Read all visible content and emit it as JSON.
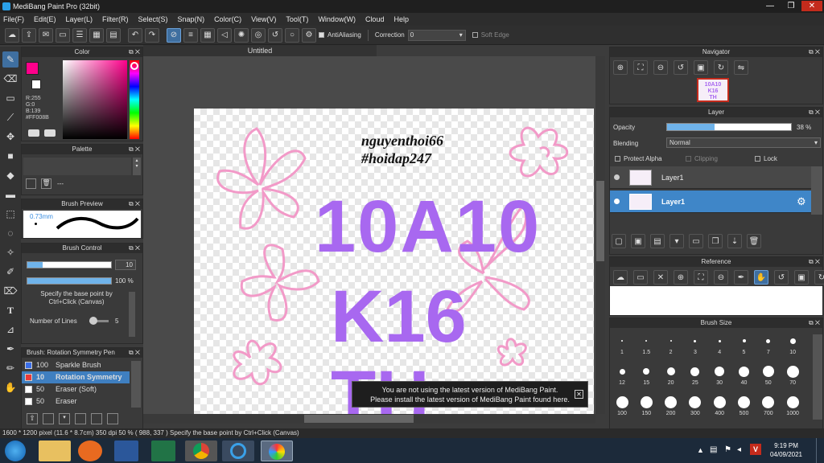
{
  "window": {
    "title": "MediBang Paint Pro (32bit)",
    "minimize": "—",
    "restore": "❐",
    "close": "✕"
  },
  "menu": [
    "File(F)",
    "Edit(E)",
    "Layer(L)",
    "Filter(R)",
    "Select(S)",
    "Snap(N)",
    "Color(C)",
    "View(V)",
    "Tool(T)",
    "Window(W)",
    "Cloud",
    "Help"
  ],
  "toolbar": {
    "antialiasing_label": "AntiAliasing",
    "correction_label": "Correction",
    "correction_value": "0",
    "soft_edge_label": "Soft Edge"
  },
  "color_panel": {
    "title": "Color",
    "r": "R:255",
    "g": "G:0",
    "b": "B:139",
    "hex": "#FF008B",
    "accent": "#ff008b"
  },
  "palette_panel": {
    "title": "Palette",
    "dash": "---"
  },
  "brush_preview": {
    "title": "Brush Preview",
    "size": "0.73mm"
  },
  "brush_control": {
    "title": "Brush Control",
    "size_value": "10",
    "opacity_value": "100 %",
    "hint": "Specify the base point by Ctrl+Click (Canvas)",
    "lines_label": "Number of Lines",
    "lines_value": "5"
  },
  "brush_list": {
    "title": "Brush: Rotation Symmetry Pen",
    "items": [
      {
        "size": "100",
        "name": "Sparkle Brush",
        "color": "#3a6ee8"
      },
      {
        "size": "10",
        "name": "Rotation Symmetry",
        "color": "#e83a3a"
      },
      {
        "size": "50",
        "name": "Eraser (Soft)",
        "color": "#ffffff"
      },
      {
        "size": "50",
        "name": "Eraser",
        "color": "#ffffff"
      }
    ]
  },
  "canvas": {
    "tab_title": "Untitled",
    "text_line1": "nguyenthoi66",
    "text_line2": "#hoidap247",
    "big_line1": "10A10",
    "big_line2": "K16",
    "big_line3": "TH",
    "notice_line1": "You are not using the latest version of MediBang Paint.",
    "notice_line2": "Please install the latest version of MediBang Paint found here."
  },
  "navigator": {
    "title": "Navigator"
  },
  "layer_panel": {
    "title": "Layer",
    "opacity_label": "Opacity",
    "opacity_value": "38 %",
    "opacity_fraction": 0.38,
    "blending_label": "Blending",
    "blending_value": "Normal",
    "protect_alpha": "Protect Alpha",
    "clipping": "Clipping",
    "lock": "Lock",
    "layers": [
      {
        "name": "Layer1"
      },
      {
        "name": "Layer1"
      }
    ]
  },
  "reference": {
    "title": "Reference"
  },
  "brush_size": {
    "title": "Brush Size",
    "sizes": [
      "1",
      "1.5",
      "2",
      "3",
      "4",
      "5",
      "7",
      "10",
      "12",
      "15",
      "20",
      "25",
      "30",
      "40",
      "50",
      "70",
      "100",
      "150",
      "200",
      "300",
      "400",
      "500",
      "700",
      "1000"
    ]
  },
  "status": {
    "text": "1600 * 1200 pixel   (11.6 * 8.7cm)   350 dpi   50 %   ( 988, 337 )   Specify the base point by Ctrl+Click (Canvas)"
  },
  "taskbar": {
    "time": "9:19 PM",
    "date": "04/09/2021",
    "tray_lang": "V"
  }
}
